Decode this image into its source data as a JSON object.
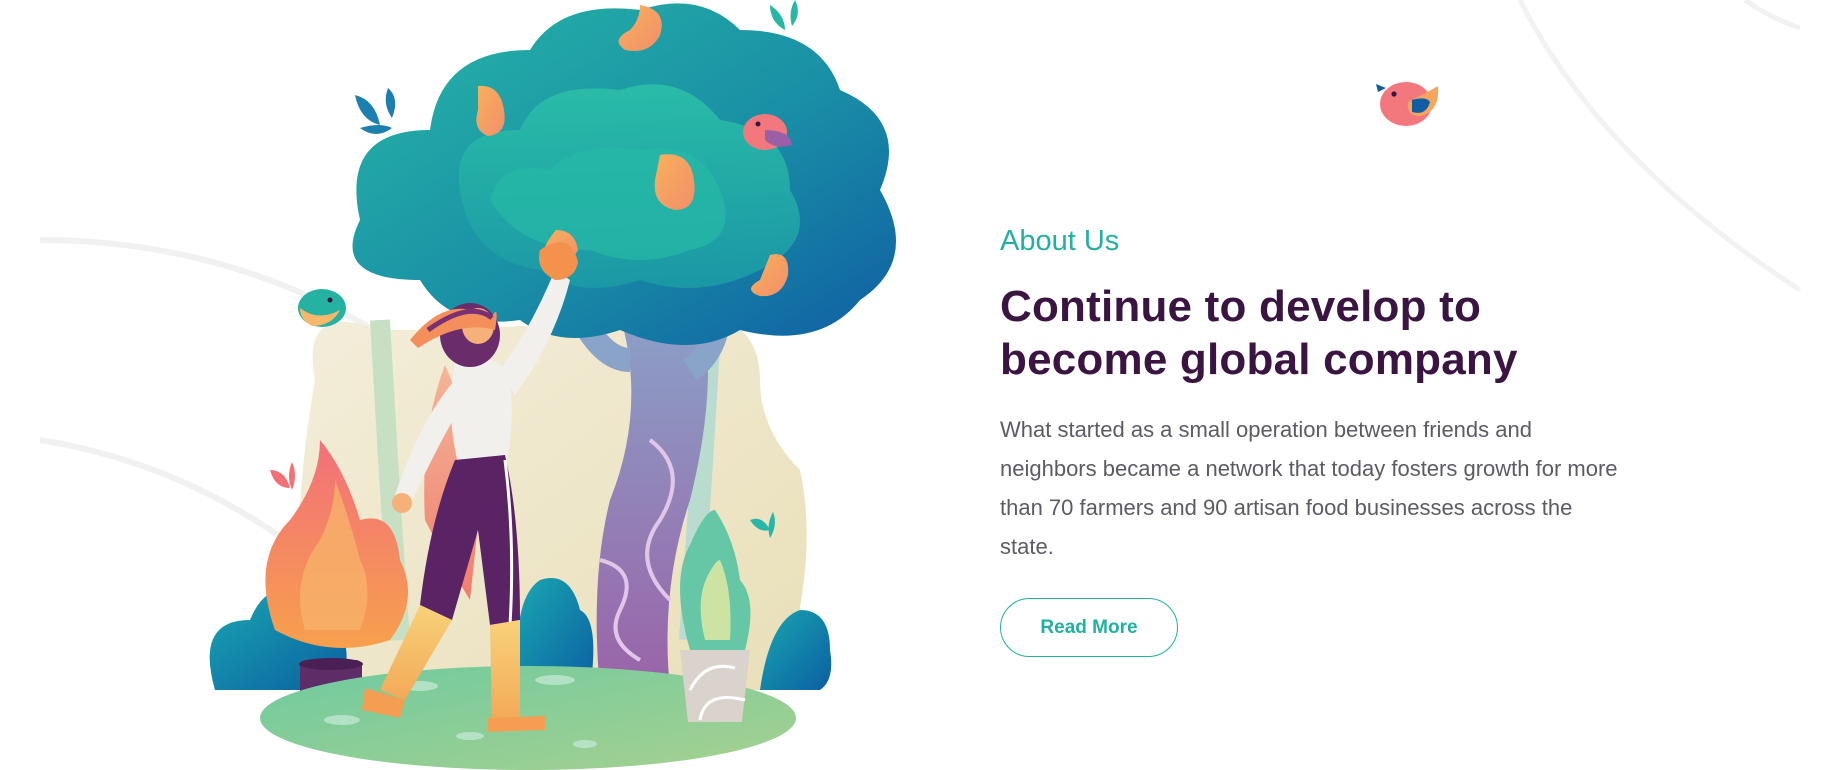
{
  "section": {
    "eyebrow": "About Us",
    "headline_line1": "Continue to develop to",
    "headline_line2": "become global company",
    "body": "What started as a small operation between friends and neighbors became a network that today fosters growth for more than 70 farmers and 90 artisan food businesses across the state.",
    "cta_label": "Read More"
  },
  "colors": {
    "accent": "#22b0a2",
    "heading": "#3b1541",
    "body_text": "#5b5b66"
  },
  "icons": {
    "illustration": "farmer-picking-fruit-illustration",
    "bird": "bird-icon"
  }
}
